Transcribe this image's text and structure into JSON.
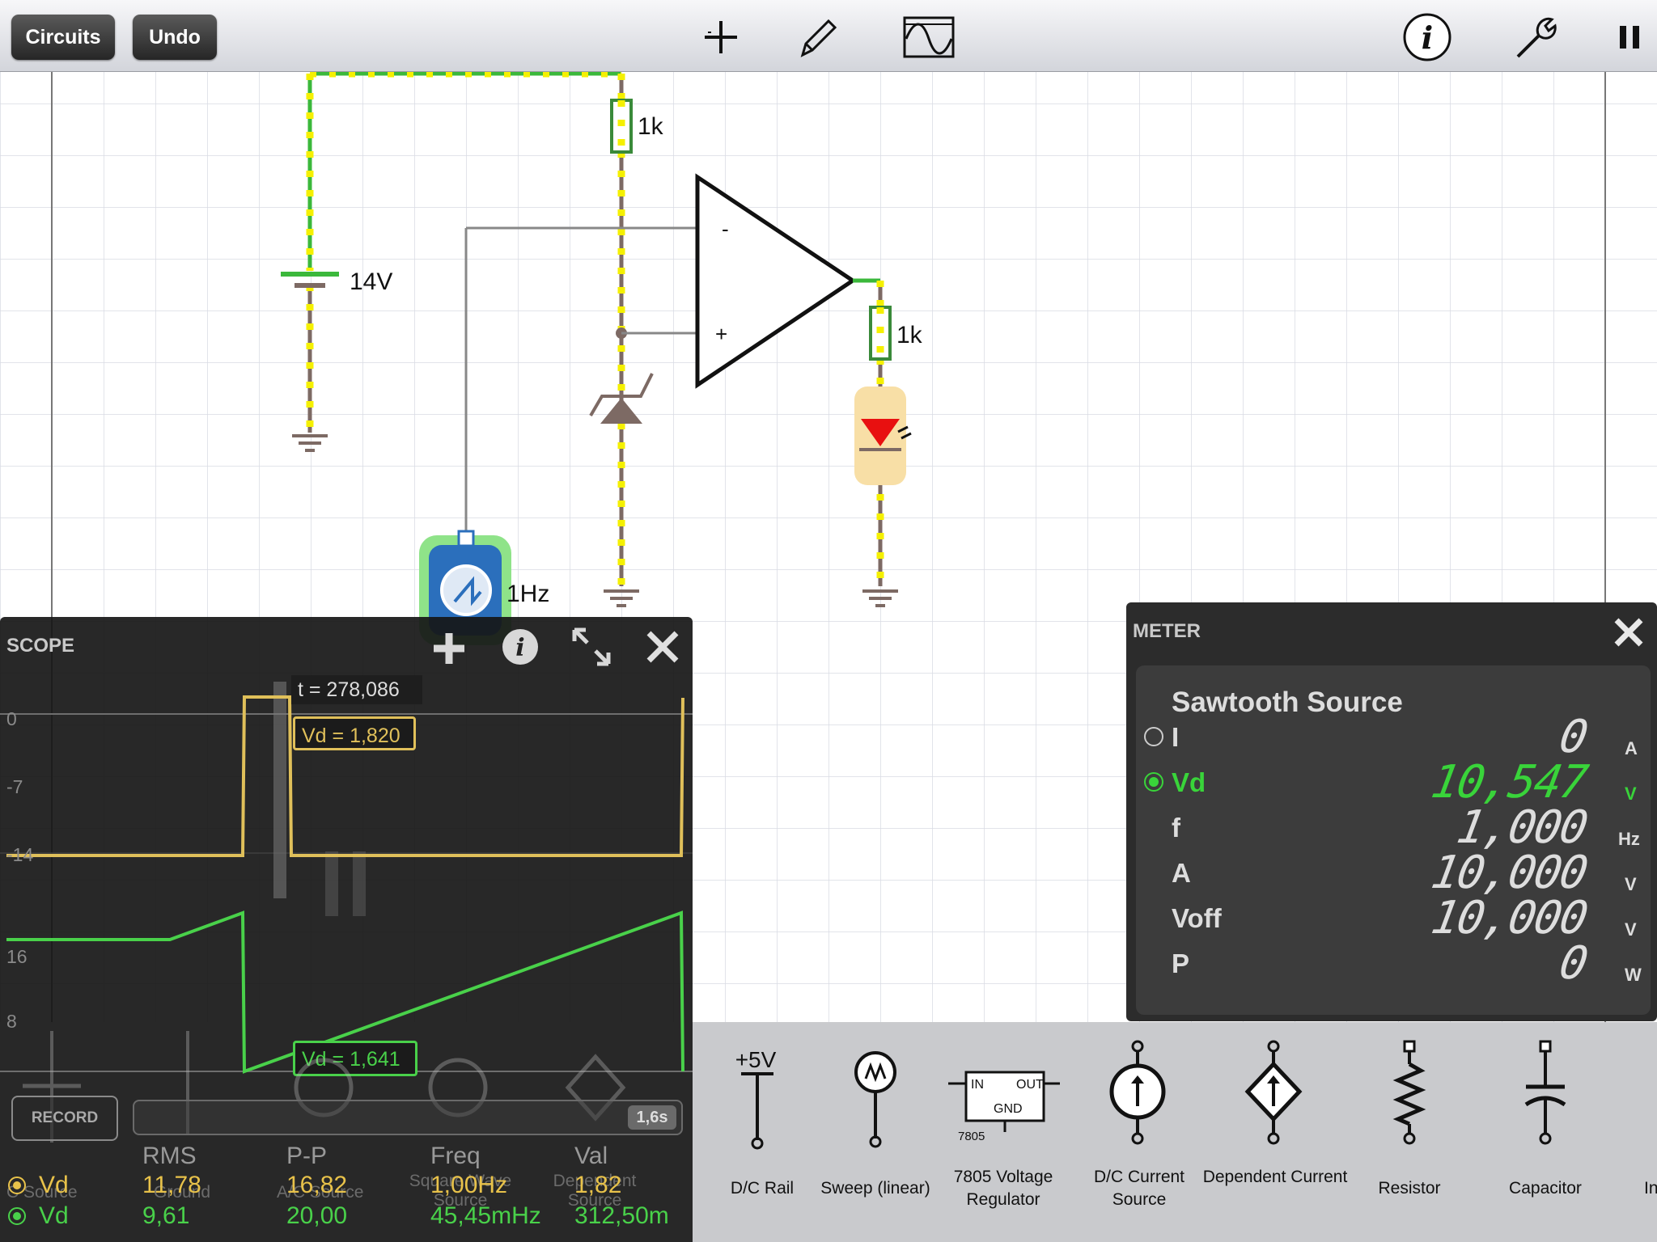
{
  "toolbar": {
    "circuits_label": "Circuits",
    "undo_label": "Undo"
  },
  "icons": [
    "add-icon",
    "pencil-icon",
    "scope-wave-icon",
    "info-icon",
    "wrench-icon",
    "pause-icon"
  ],
  "circuit": {
    "r_top_label": "1k",
    "battery_label": "14V",
    "r_out_label": "1k",
    "source_label": "1Hz",
    "opamp_minus": "-",
    "opamp_plus": "+"
  },
  "scope": {
    "title": "SCOPE",
    "cursor_time": "t = 278,086",
    "cursor_vd_yellow": "Vd = 1,820",
    "cursor_vd_green": "Vd = 1,641",
    "axis_labels": {
      "l0": "0",
      "l_7": "-7",
      "l_14": "-14",
      "l16": "16",
      "l8": "8"
    },
    "record_label": "RECORD",
    "timebase": "1,6s",
    "col_headers": {
      "rms": "RMS",
      "pp": "P-P",
      "freq": "Freq",
      "val": "Val"
    },
    "rows": [
      {
        "name": "Vd",
        "rms": "11,78",
        "pp": "16,82",
        "freq": "1,00Hz",
        "val": "1,82",
        "color": "#e8c24a"
      },
      {
        "name": "Vd",
        "rms": "9,61",
        "pp": "20,00",
        "freq": "45,45mHz",
        "val": "312,50m",
        "color": "#49d14a"
      }
    ],
    "ghost_labels": {
      "a": "C Source",
      "b": "Ground",
      "c": "A/C Source",
      "d": "Square Wave Source",
      "e": "Dependent Source"
    }
  },
  "meter": {
    "title": "METER",
    "component": "Sawtooth Source",
    "rows": [
      {
        "label": "I",
        "value": "0",
        "unit": "A"
      },
      {
        "label": "Vd",
        "value": "10,547",
        "unit": "V"
      },
      {
        "label": "f",
        "value": "1,000",
        "unit": "Hz"
      },
      {
        "label": "A",
        "value": "10,000",
        "unit": "V"
      },
      {
        "label": "Voff",
        "value": "10,000",
        "unit": "V"
      },
      {
        "label": "P",
        "value": "0",
        "unit": "W"
      }
    ],
    "highlight_color": "#39d43a"
  },
  "tray": {
    "rail_value": "+5V",
    "ic_in": "IN",
    "ic_out": "OUT",
    "ic_gnd": "GND",
    "ic_num": "7805",
    "items": [
      "D/C Rail",
      "Sweep (linear)",
      "7805 Voltage Regulator",
      "D/C Current Source",
      "Dependent Current",
      "Resistor",
      "Capacitor",
      "In"
    ]
  }
}
